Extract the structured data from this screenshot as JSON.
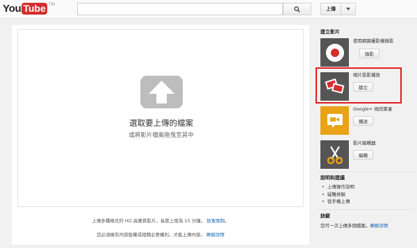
{
  "header": {
    "logo_you": "You",
    "logo_tube": "Tube",
    "logo_region": "TW",
    "search_value": "",
    "search_icon": "magnifier-icon",
    "upload_label": "上傳",
    "upload_menu_icon": "chevron-down-icon"
  },
  "main": {
    "upload_icon": "upload-arrow-icon",
    "drop_title": "選取要上傳的檔案",
    "drop_subtitle": "或將影片檔案拖曳至其中",
    "note1_text": "上傳多種格式的 HD 高畫質影片，長度上限為 15 分鐘。",
    "note1_link": "放寬限制",
    "note1_suffix": "。",
    "note2_text": "您必須擁有內容版權或相關必要權利，才能上傳內容。",
    "note2_link": "瞭解詳情"
  },
  "sidebar": {
    "create_heading": "建立影片",
    "cards": [
      {
        "icon": "webcam-record-icon",
        "label": "使用網路攝影機錄影",
        "button": "錄影",
        "thumb_color": "#555555"
      },
      {
        "icon": "photo-slideshow-icon",
        "label": "相片投影播放",
        "button": "建立",
        "thumb_color": "#555555"
      },
      {
        "icon": "hangout-video-icon",
        "label": "Google+ 視訊聚會",
        "button": "播送",
        "thumb_color": "#e8a317"
      },
      {
        "icon": "scissors-icon",
        "label": "影片編輯器",
        "button": "編輯",
        "thumb_color": "#555555"
      }
    ],
    "help_heading": "說明和建議",
    "help_items": [
      "上傳操作說明",
      "疑難排解",
      "從手機上傳"
    ],
    "tip_heading": "訣竅",
    "tip_text": "您可一次上傳多個檔案。",
    "tip_link": "瞭解詳情",
    "highlight_color": "#e21b1b"
  }
}
